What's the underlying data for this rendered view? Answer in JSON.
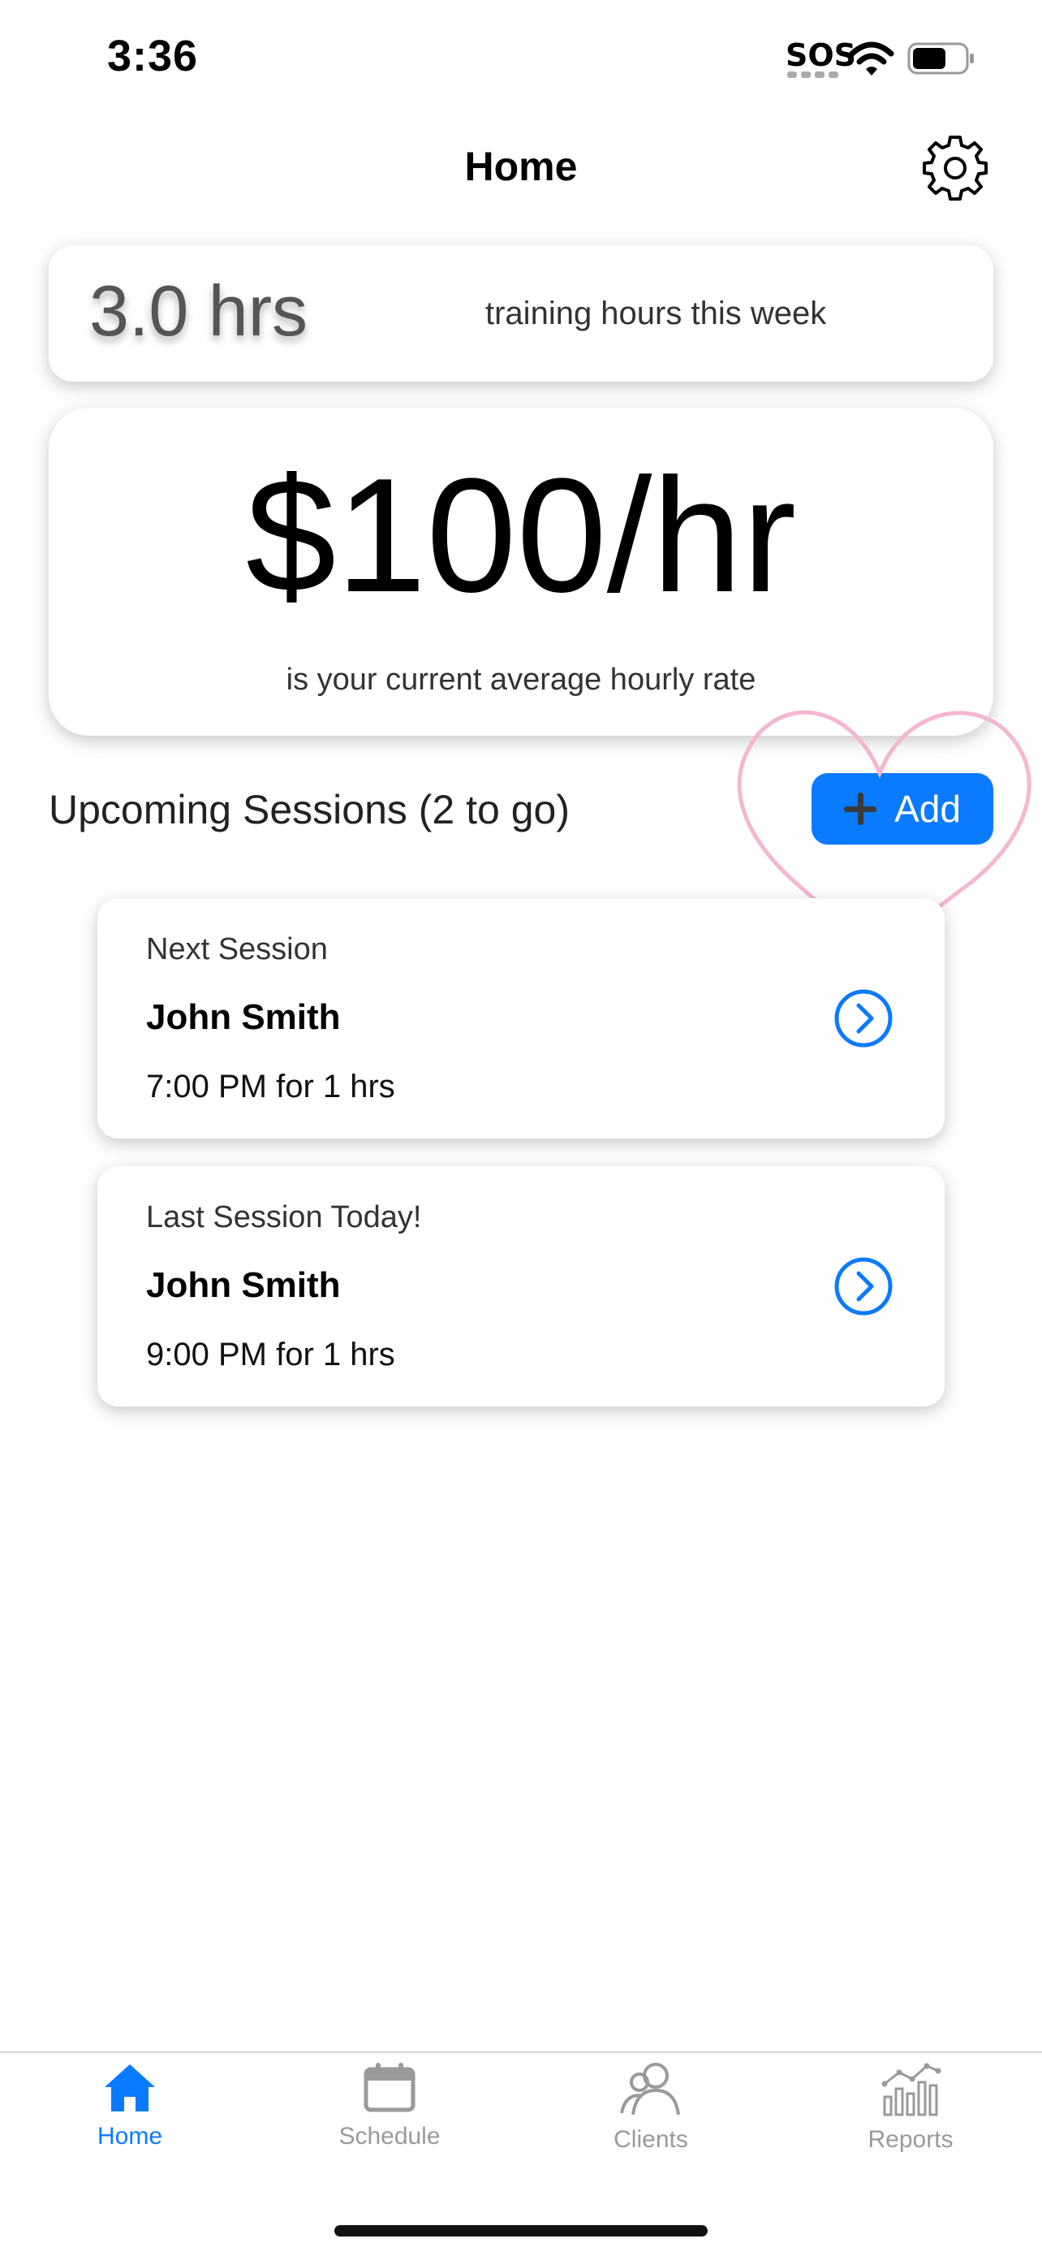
{
  "status_bar": {
    "time": "3:36",
    "sos": "SOS",
    "icons": [
      "wifi-icon",
      "battery-icon"
    ]
  },
  "header": {
    "title": "Home",
    "settings_icon": "gear-icon"
  },
  "hours_card": {
    "value": "3.0 hrs",
    "label": "training hours this week"
  },
  "rate_card": {
    "value": "$100/hr",
    "label": "is your current average hourly rate"
  },
  "upcoming": {
    "title": "Upcoming Sessions (2 to go)",
    "add_label": "Add"
  },
  "sessions": [
    {
      "label": "Next Session",
      "name": "John Smith",
      "time": "7:00 PM for 1 hrs"
    },
    {
      "label": "Last Session Today!",
      "name": "John Smith",
      "time": "9:00 PM for 1 hrs"
    }
  ],
  "tabs": [
    {
      "label": "Home",
      "icon": "home-icon",
      "active": true
    },
    {
      "label": "Schedule",
      "icon": "calendar-icon",
      "active": false
    },
    {
      "label": "Clients",
      "icon": "clients-icon",
      "active": false
    },
    {
      "label": "Reports",
      "icon": "reports-icon",
      "active": false
    }
  ],
  "colors": {
    "accent": "#0a7aff",
    "annotation_heart": "#f7b6cf",
    "inactive_tab": "#9a9a9a"
  }
}
